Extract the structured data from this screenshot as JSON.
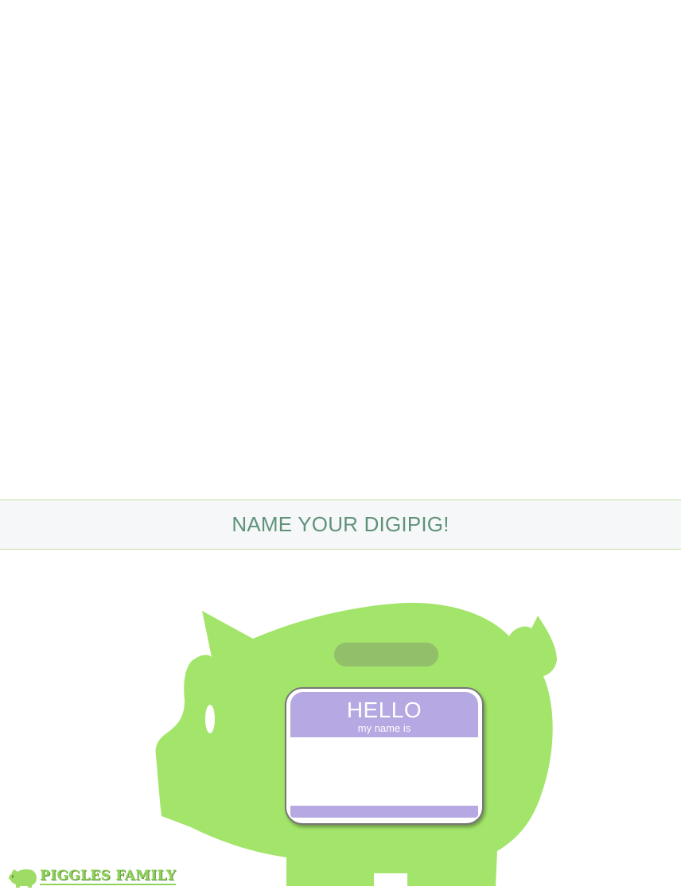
{
  "header": {
    "title": "NAME YOUR DIGIPIG!"
  },
  "name_tag": {
    "hello": "HELLO",
    "subtitle": "my name is",
    "name_value": "",
    "name_placeholder": ""
  },
  "footer": {
    "logo_text": "PIGGLES FAMILY"
  },
  "colors": {
    "pig_green": "#a3e56a",
    "slot_green": "#92bf6a",
    "title_text": "#5f927b",
    "title_border": "#c3e0a6",
    "tag_purple": "#b6a8e2",
    "title_bar_bg": "#f6f7f8"
  },
  "icons": {
    "pig": "pig-icon",
    "logo_pig": "logo-pig-icon"
  }
}
